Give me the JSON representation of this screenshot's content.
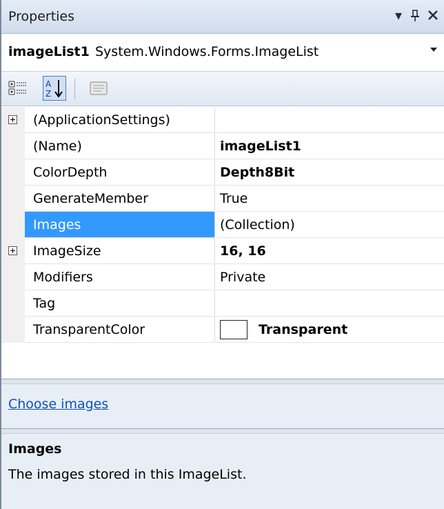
{
  "window": {
    "title": "Properties",
    "dropdown_icon": "▾",
    "pin_icon": "ᵻ",
    "close_icon": "✕"
  },
  "object_selector": {
    "name": "imageList1",
    "type": "System.Windows.Forms.ImageList"
  },
  "toolbar": {
    "categorized_icon": "categorized-icon",
    "alphabetical_icon": "alphabetical-icon",
    "property_pages_icon": "property-pages-icon",
    "alphabetical_active": true
  },
  "grid": {
    "rows": [
      {
        "name": "(ApplicationSettings)",
        "value": "",
        "expandable": true,
        "bold": false
      },
      {
        "name": "(Name)",
        "value": "imageList1",
        "expandable": false,
        "bold": true
      },
      {
        "name": "ColorDepth",
        "value": "Depth8Bit",
        "expandable": false,
        "bold": true
      },
      {
        "name": "GenerateMember",
        "value": "True",
        "expandable": false,
        "bold": false
      },
      {
        "name": "Images",
        "value": "(Collection)",
        "expandable": false,
        "bold": false,
        "selected": true,
        "ellipsis": "..."
      },
      {
        "name": "ImageSize",
        "value": "16, 16",
        "expandable": true,
        "bold": true
      },
      {
        "name": "Modifiers",
        "value": "Private",
        "expandable": false,
        "bold": false
      },
      {
        "name": "Tag",
        "value": "",
        "expandable": false,
        "bold": false
      },
      {
        "name": "TransparentColor",
        "value": "Transparent",
        "expandable": false,
        "bold": true,
        "swatch_color": "#ffffff"
      }
    ]
  },
  "commands": {
    "link": "Choose images"
  },
  "description": {
    "title": "Images",
    "text": "The images stored in this ImageList."
  },
  "colors": {
    "selection": "#3399ff",
    "link": "#0d52b8",
    "panel_bg": "#e8eef6"
  }
}
